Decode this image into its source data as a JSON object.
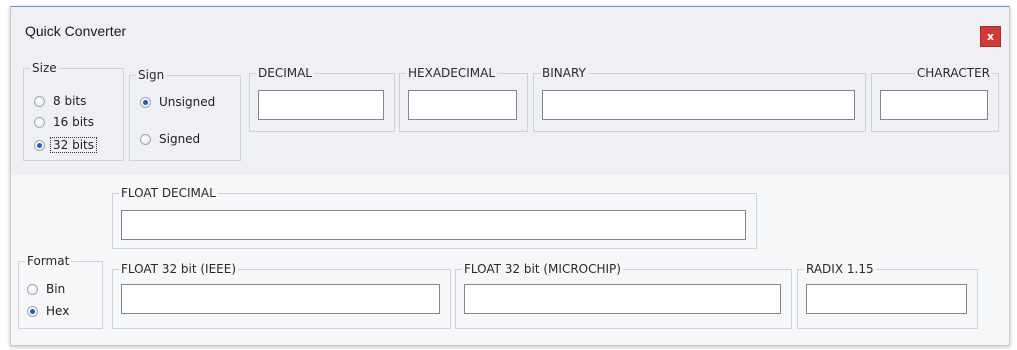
{
  "window": {
    "title": "Quick Converter",
    "close_label": "x"
  },
  "size_group": {
    "legend": "Size",
    "options": [
      {
        "label": "8 bits",
        "selected": false
      },
      {
        "label": "16 bits",
        "selected": false
      },
      {
        "label": "32 bits",
        "selected": true
      }
    ]
  },
  "sign_group": {
    "legend": "Sign",
    "options": [
      {
        "label": "Unsigned",
        "selected": true
      },
      {
        "label": "Signed",
        "selected": false
      }
    ]
  },
  "fields": {
    "decimal": {
      "label": "DECIMAL",
      "value": ""
    },
    "hexadecimal": {
      "label": "HEXADECIMAL",
      "value": ""
    },
    "binary": {
      "label": "BINARY",
      "value": ""
    },
    "character": {
      "label": "CHARACTER",
      "value": ""
    },
    "float_decimal": {
      "label": "FLOAT DECIMAL",
      "value": ""
    },
    "float32_ieee": {
      "label": "FLOAT 32 bit (IEEE)",
      "value": ""
    },
    "float32_microchip": {
      "label": "FLOAT 32 bit (MICROCHIP)",
      "value": ""
    },
    "radix_115": {
      "label": "RADIX 1.15",
      "value": ""
    }
  },
  "format_group": {
    "legend": "Format",
    "options": [
      {
        "label": "Bin",
        "selected": false
      },
      {
        "label": "Hex",
        "selected": true
      }
    ]
  },
  "colors": {
    "accent": "#1f5fbf",
    "close_button": "#d23a3a"
  }
}
